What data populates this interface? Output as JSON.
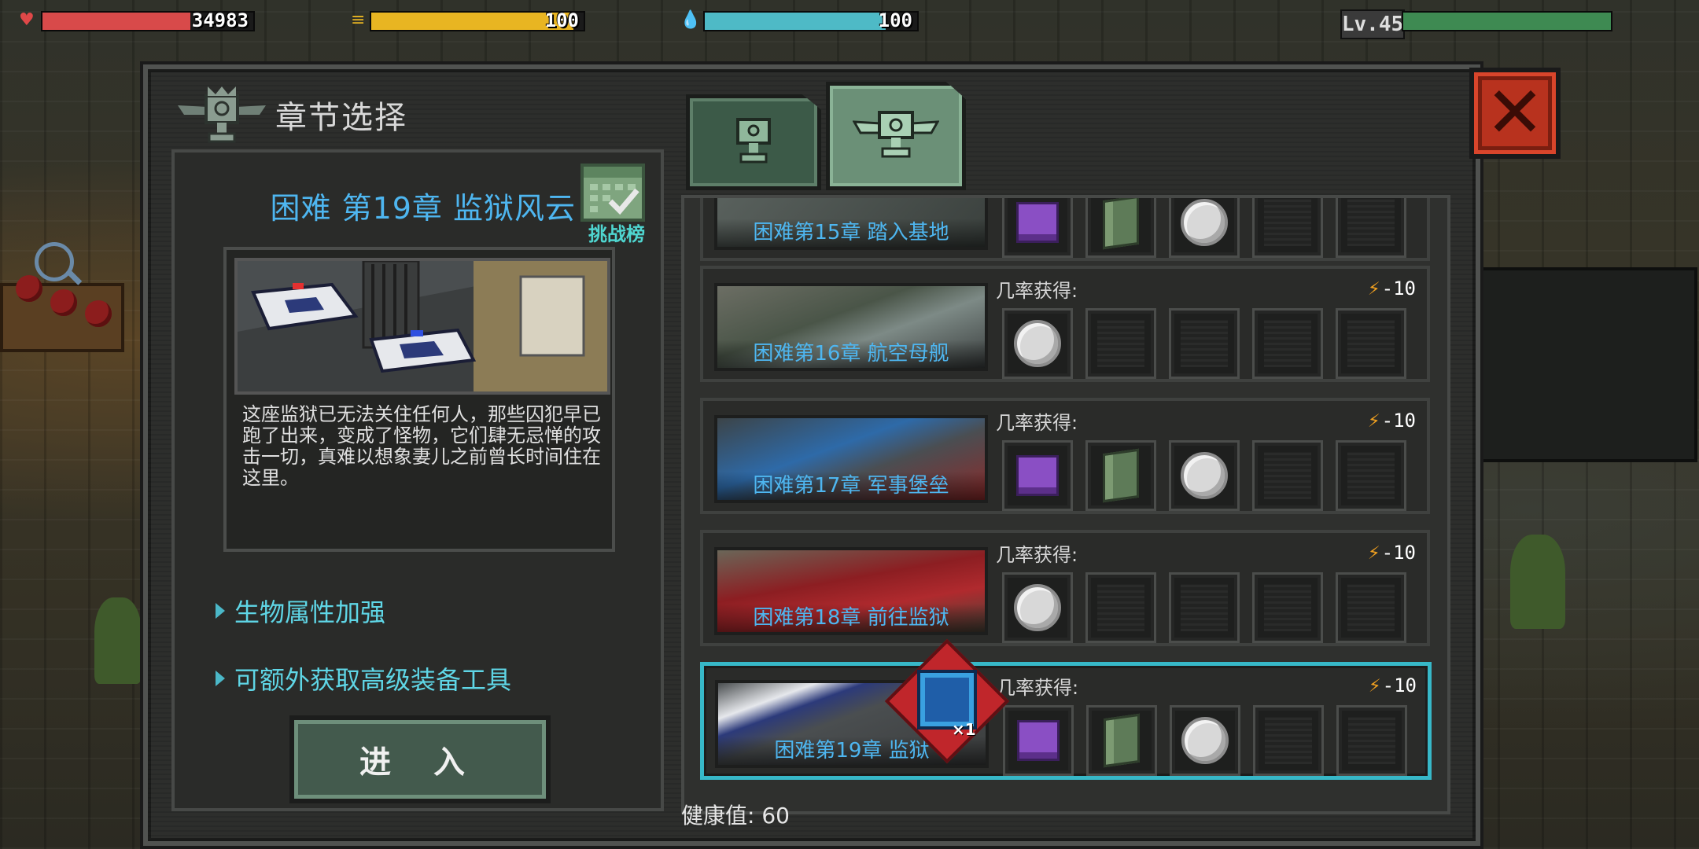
{
  "hud": {
    "health_value": "34983",
    "food_value": "100",
    "water_value": "100",
    "level": "Lv.45",
    "health_fill": 0.7,
    "food_fill": 0.95,
    "water_fill": 0.85,
    "xp_fill": 1.0,
    "colors": {
      "health": "#d84a4a",
      "food": "#e8b522",
      "water": "#4ebac6",
      "xp": "#3e8a52"
    }
  },
  "dialog": {
    "title": "章节选择",
    "close_icon": "close-x-icon",
    "tabs": [
      {
        "icon": "trophy-icon",
        "active": false
      },
      {
        "icon": "winged-trophy-icon",
        "active": true
      }
    ]
  },
  "detail": {
    "chapter_title": "困难 第19章 监狱风云",
    "challenge_label": "挑战榜",
    "description": "这座监狱已无法关住任何人，那些囚犯早已跑了出来，变成了怪物，它们肆无忌惮的攻击一切，真难以想象妻儿之前曾长时间住在这里。",
    "perks": [
      "生物属性加强",
      "可额外获取高级装备工具"
    ],
    "enter_label": "进 入"
  },
  "chapters": [
    {
      "name": "困难第15章 踏入基地",
      "odds_label": "",
      "cost": "",
      "items": [
        "device",
        "scroll",
        "coin",
        "empty",
        "empty"
      ],
      "selected": false
    },
    {
      "name": "困难第16章 航空母舰",
      "odds_label": "几率获得:",
      "cost": "-10",
      "items": [
        "coin",
        "empty",
        "empty",
        "empty",
        "empty"
      ],
      "selected": false
    },
    {
      "name": "困难第17章 军事堡垒",
      "odds_label": "几率获得:",
      "cost": "-10",
      "items": [
        "device",
        "scroll",
        "coin",
        "empty",
        "empty"
      ],
      "selected": false
    },
    {
      "name": "困难第18章 前往监狱",
      "odds_label": "几率获得:",
      "cost": "-10",
      "items": [
        "coin",
        "empty",
        "empty",
        "empty",
        "empty"
      ],
      "selected": false
    },
    {
      "name": "困难第19章 监狱",
      "odds_label": "几率获得:",
      "cost": "-10",
      "items": [
        "device",
        "scroll",
        "coin",
        "empty",
        "empty"
      ],
      "selected": true
    }
  ],
  "badge": {
    "icon": "blue-chip-icon",
    "count": "×1"
  },
  "health_label": "健康值: 60"
}
